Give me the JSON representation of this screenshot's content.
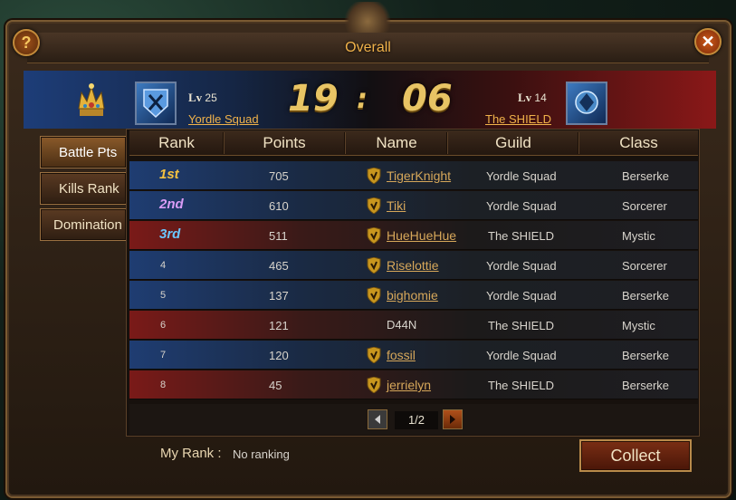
{
  "title": "Overall",
  "help_label": "?",
  "close_label": "✕",
  "left_team": {
    "level_label": "Lv",
    "level": "25",
    "name": "Yordle Squad"
  },
  "right_team": {
    "level_label": "Lv",
    "level": "14",
    "name": "The SHIELD"
  },
  "timer": {
    "minutes": "19",
    "separator": ":",
    "seconds": "06"
  },
  "tabs": [
    {
      "label": "Battle Pts",
      "active": true
    },
    {
      "label": "Kills Rank",
      "active": false
    },
    {
      "label": "Domination",
      "active": false
    }
  ],
  "columns": [
    "Rank",
    "Points",
    "Name",
    "Guild",
    "Class"
  ],
  "rows": [
    {
      "rank": "1st",
      "points": "705",
      "name": "TigerKnight",
      "guild": "Yordle Squad",
      "class": "Berserke",
      "team": "blue",
      "badge": true,
      "style": "gold"
    },
    {
      "rank": "2nd",
      "points": "610",
      "name": "Tiki",
      "guild": "Yordle Squad",
      "class": "Sorcerer",
      "team": "blue",
      "badge": true,
      "style": "purple"
    },
    {
      "rank": "3rd",
      "points": "511",
      "name": "HueHueHue",
      "guild": "The SHIELD",
      "class": "Mystic",
      "team": "red",
      "badge": true,
      "style": "blue"
    },
    {
      "rank": "4",
      "points": "465",
      "name": "Riselottie",
      "guild": "Yordle Squad",
      "class": "Sorcerer",
      "team": "blue",
      "badge": true,
      "style": "n"
    },
    {
      "rank": "5",
      "points": "137",
      "name": "bighomie",
      "guild": "Yordle Squad",
      "class": "Berserke",
      "team": "blue",
      "badge": true,
      "style": "n"
    },
    {
      "rank": "6",
      "points": "121",
      "name": "D44N",
      "guild": "The SHIELD",
      "class": "Mystic",
      "team": "red",
      "badge": false,
      "style": "n"
    },
    {
      "rank": "7",
      "points": "120",
      "name": "fossil",
      "guild": "Yordle Squad",
      "class": "Berserke",
      "team": "blue",
      "badge": true,
      "style": "n"
    },
    {
      "rank": "8",
      "points": "45",
      "name": "jerrielyn",
      "guild": "The SHIELD",
      "class": "Berserke",
      "team": "red",
      "badge": true,
      "style": "n"
    }
  ],
  "pager": {
    "page": "1/2"
  },
  "my_rank": {
    "label": "My Rank :",
    "value": "No ranking"
  },
  "collect_label": "Collect",
  "icons": {
    "crown": "crown-icon",
    "badge": "shield-badge-icon",
    "emblem": "guild-emblem-icon"
  },
  "colors": {
    "gold": "#f6c240",
    "accent": "#f0b24a",
    "blue_team": "#1f3d72",
    "red_team": "#7a1a18"
  }
}
